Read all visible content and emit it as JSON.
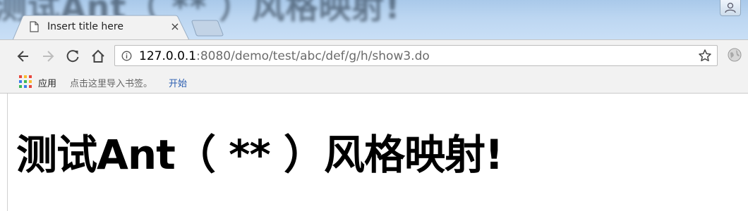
{
  "tab": {
    "title": "Insert title here",
    "close_glyph": "×"
  },
  "address_bar": {
    "url_host": "127.0.0.1",
    "url_rest": ":8080/demo/test/abc/def/g/h/show3.do"
  },
  "bookmarks": {
    "apps_label": "应用",
    "import_hint": "点击这里导入书签。",
    "link_label": "开始"
  },
  "page": {
    "heading": "测试Ant（ ** ）风格映射!"
  },
  "colors": {
    "titlebar": "#bcd6f1",
    "toolbar": "#f2f2f2",
    "link": "#2a5db0"
  },
  "icons": [
    "page-icon",
    "back-arrow-icon",
    "forward-arrow-icon",
    "reload-icon",
    "home-icon",
    "info-icon",
    "star-icon",
    "globe-icon",
    "apps-grid-icon",
    "user-icon"
  ]
}
